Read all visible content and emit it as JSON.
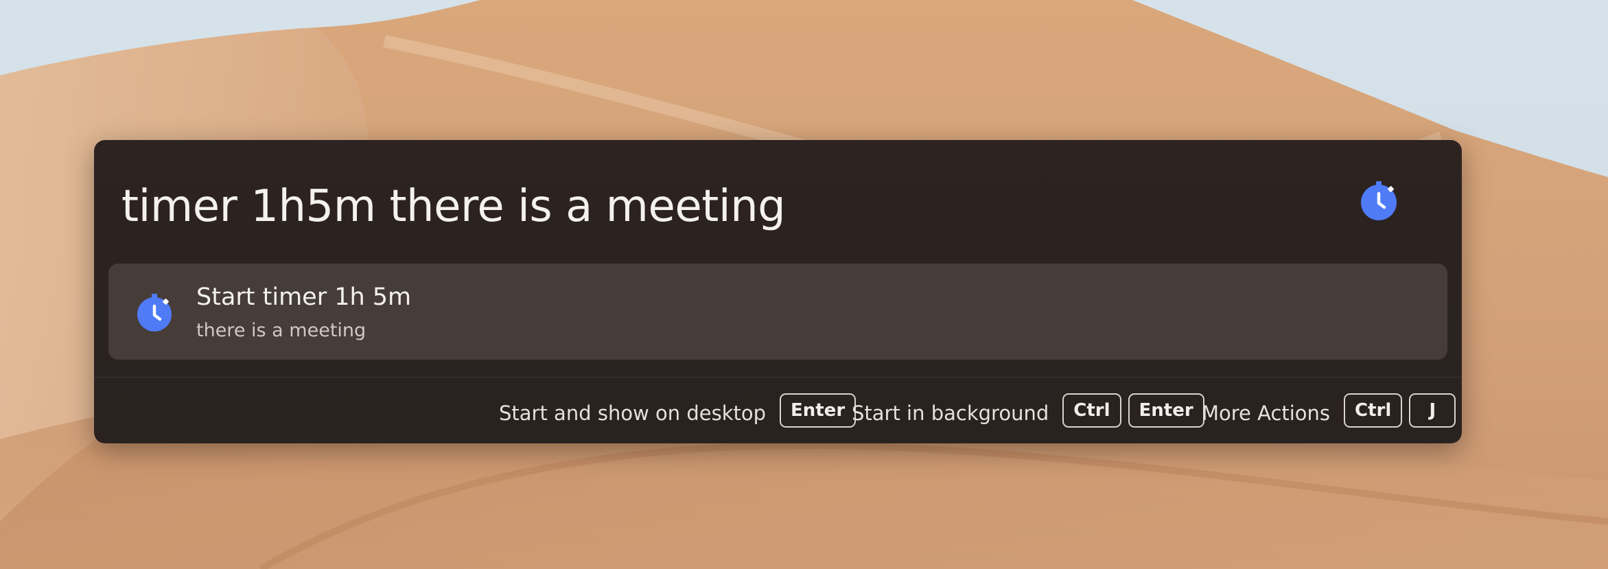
{
  "launcher": {
    "query": "timer 1h5m there is a meeting",
    "query_icon": "stopwatch-icon",
    "results": [
      {
        "icon": "stopwatch-icon",
        "title": "Start timer 1h 5m",
        "subtitle": "there is a meeting"
      }
    ],
    "footer": {
      "actions": [
        {
          "label": "Start and show on desktop",
          "keys": [
            "Enter"
          ]
        },
        {
          "label": "Start in background",
          "keys": [
            "Ctrl",
            "Enter"
          ]
        },
        {
          "label": "More Actions",
          "keys": [
            "Ctrl",
            "J"
          ]
        }
      ]
    }
  },
  "colors": {
    "accent": "#4f7bf7",
    "window_bg": "#2c2320",
    "selected_item_bg": "#463d39",
    "text_primary": "#f4f1ef",
    "text_secondary": "#cfc8c4"
  }
}
